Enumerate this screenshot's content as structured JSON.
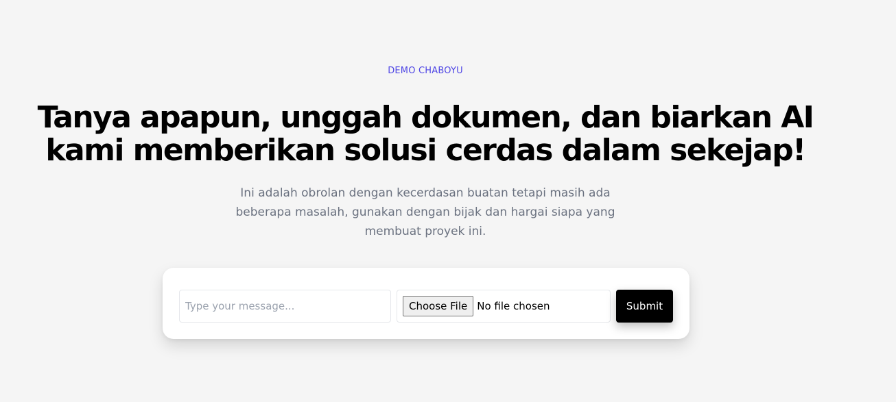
{
  "hero": {
    "eyebrow": "DEMO CHABOYU",
    "headline_line1": "Tanya apapun, unggah dokumen, dan biarkan AI",
    "headline_line2": "kami memberikan solusi cerdas dalam sekejap!",
    "description_line1": "Ini adalah obrolan dengan kecerdasan buatan tetapi masih ada",
    "description_line2": "beberapa masalah, gunakan dengan bijak dan hargai siapa yang",
    "description_line3": "membuat proyek ini."
  },
  "form": {
    "message_placeholder": "Type your message...",
    "message_value": "",
    "file_button_label": "Choose File",
    "file_status": "No file chosen",
    "submit_label": "Submit"
  },
  "colors": {
    "background": "#f5f5f5",
    "accent": "#4f46e5",
    "headline": "#000000",
    "description": "#6b7280",
    "submit_bg": "#000000"
  }
}
